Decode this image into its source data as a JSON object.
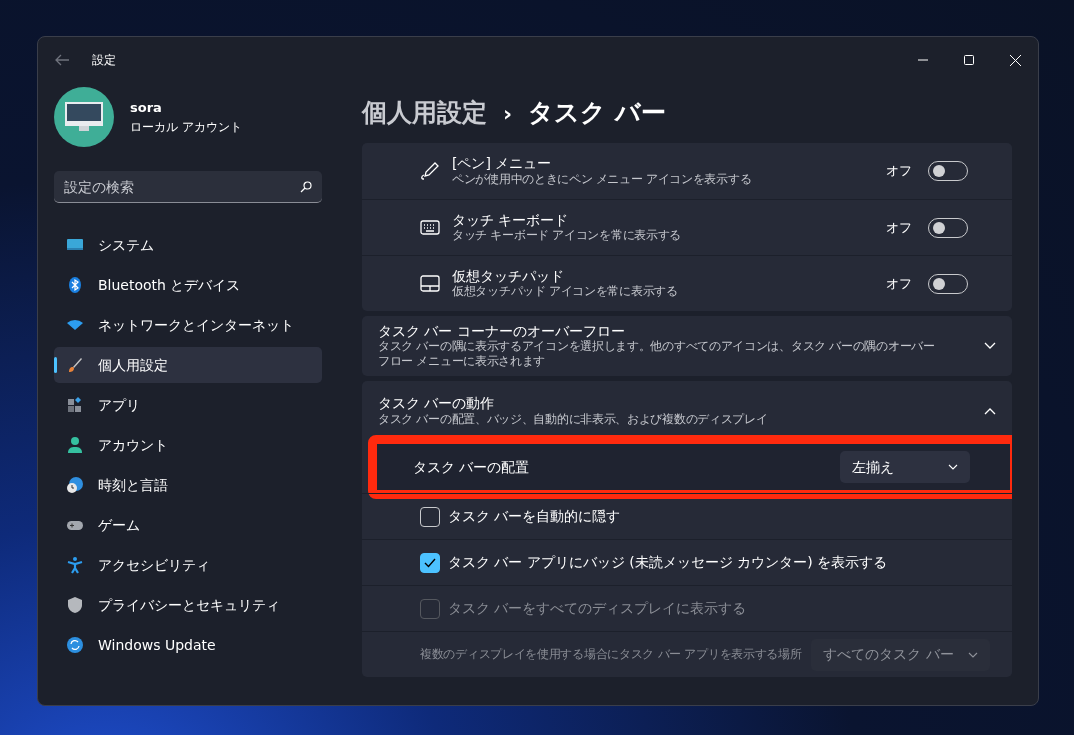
{
  "window": {
    "title": "設定"
  },
  "account": {
    "name": "sora",
    "type": "ローカル アカウント"
  },
  "search": {
    "placeholder": "設定の検索"
  },
  "nav": [
    {
      "label": "システム",
      "selected": false
    },
    {
      "label": "Bluetooth とデバイス",
      "selected": false
    },
    {
      "label": "ネットワークとインターネット",
      "selected": false
    },
    {
      "label": "個人用設定",
      "selected": true
    },
    {
      "label": "アプリ",
      "selected": false
    },
    {
      "label": "アカウント",
      "selected": false
    },
    {
      "label": "時刻と言語",
      "selected": false
    },
    {
      "label": "ゲーム",
      "selected": false
    },
    {
      "label": "アクセシビリティ",
      "selected": false
    },
    {
      "label": "プライバシーとセキュリティ",
      "selected": false
    },
    {
      "label": "Windows Update",
      "selected": false
    }
  ],
  "breadcrumb": {
    "parent": "個人用設定",
    "separator": "›",
    "current": "タスク バー"
  },
  "toggle_rows": [
    {
      "title": "[ペン] メニュー",
      "description": "ペンが使用中のときにペン メニュー アイコンを表示する",
      "state_label": "オフ",
      "on": false
    },
    {
      "title": "タッチ キーボード",
      "description": "タッチ キーボード アイコンを常に表示する",
      "state_label": "オフ",
      "on": false
    },
    {
      "title": "仮想タッチパッド",
      "description": "仮想タッチパッド アイコンを常に表示する",
      "state_label": "オフ",
      "on": false
    }
  ],
  "expanders": [
    {
      "title": "タスク バー コーナーのオーバーフロー",
      "description": "タスク バーの隅に表示するアイコンを選択します。他のすべてのアイコンは、タスク バーの隅のオーバーフロー メニューに表示されます",
      "expanded": false
    },
    {
      "title": "タスク バーの動作",
      "description": "タスク バーの配置、バッジ、自動的に非表示、および複数のディスプレイ",
      "expanded": true,
      "children": [
        {
          "kind": "dropdown",
          "label": "タスク バーの配置",
          "value": "左揃え",
          "highlighted": true,
          "disabled": false
        },
        {
          "kind": "checkbox",
          "label": "タスク バーを自動的に隠す",
          "checked": false,
          "disabled": false
        },
        {
          "kind": "checkbox",
          "label": "タスク バー アプリにバッジ (未読メッセージ カウンター) を表示する",
          "checked": true,
          "disabled": false
        },
        {
          "kind": "checkbox",
          "label": "タスク バーをすべてのディスプレイに表示する",
          "checked": false,
          "disabled": true
        },
        {
          "kind": "dropdown",
          "label": "複数のディスプレイを使用する場合にタスク バー アプリを表示する場所",
          "value": "すべてのタスク バー",
          "highlighted": false,
          "disabled": true
        }
      ]
    }
  ]
}
